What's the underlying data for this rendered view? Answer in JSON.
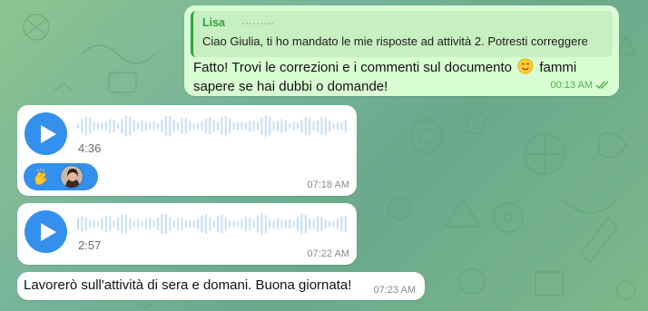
{
  "outgoing": {
    "reply_sender": "Lisa",
    "reply_preview": "Ciao Giulia, ti ho mandato le mie risposte ad attività 2. Potresti correggere",
    "text_part1": "Fatto! Trovi le correzioni e i commenti sul documento",
    "emoji": "smiling-face-emoji",
    "text_part2": "fammi sapere se hai dubbi o domande!",
    "time": "00:13 AM",
    "status": "read"
  },
  "voice_messages": [
    {
      "duration": "4:36",
      "time": "07:18 AM",
      "reactions": [
        "clapping-hands-emoji",
        "user-avatar"
      ]
    },
    {
      "duration": "2:57",
      "time": "07:22 AM"
    }
  ],
  "incoming_text": {
    "text": "Lavorerò sull'attività di sera e domani. Buona giornata!",
    "time": "07:23 AM"
  },
  "colors": {
    "accent": "#3390ec",
    "outgoing_bubble": "#d9fdd3",
    "incoming_bubble": "#ffffff",
    "reply_accent": "#2fa53b"
  }
}
